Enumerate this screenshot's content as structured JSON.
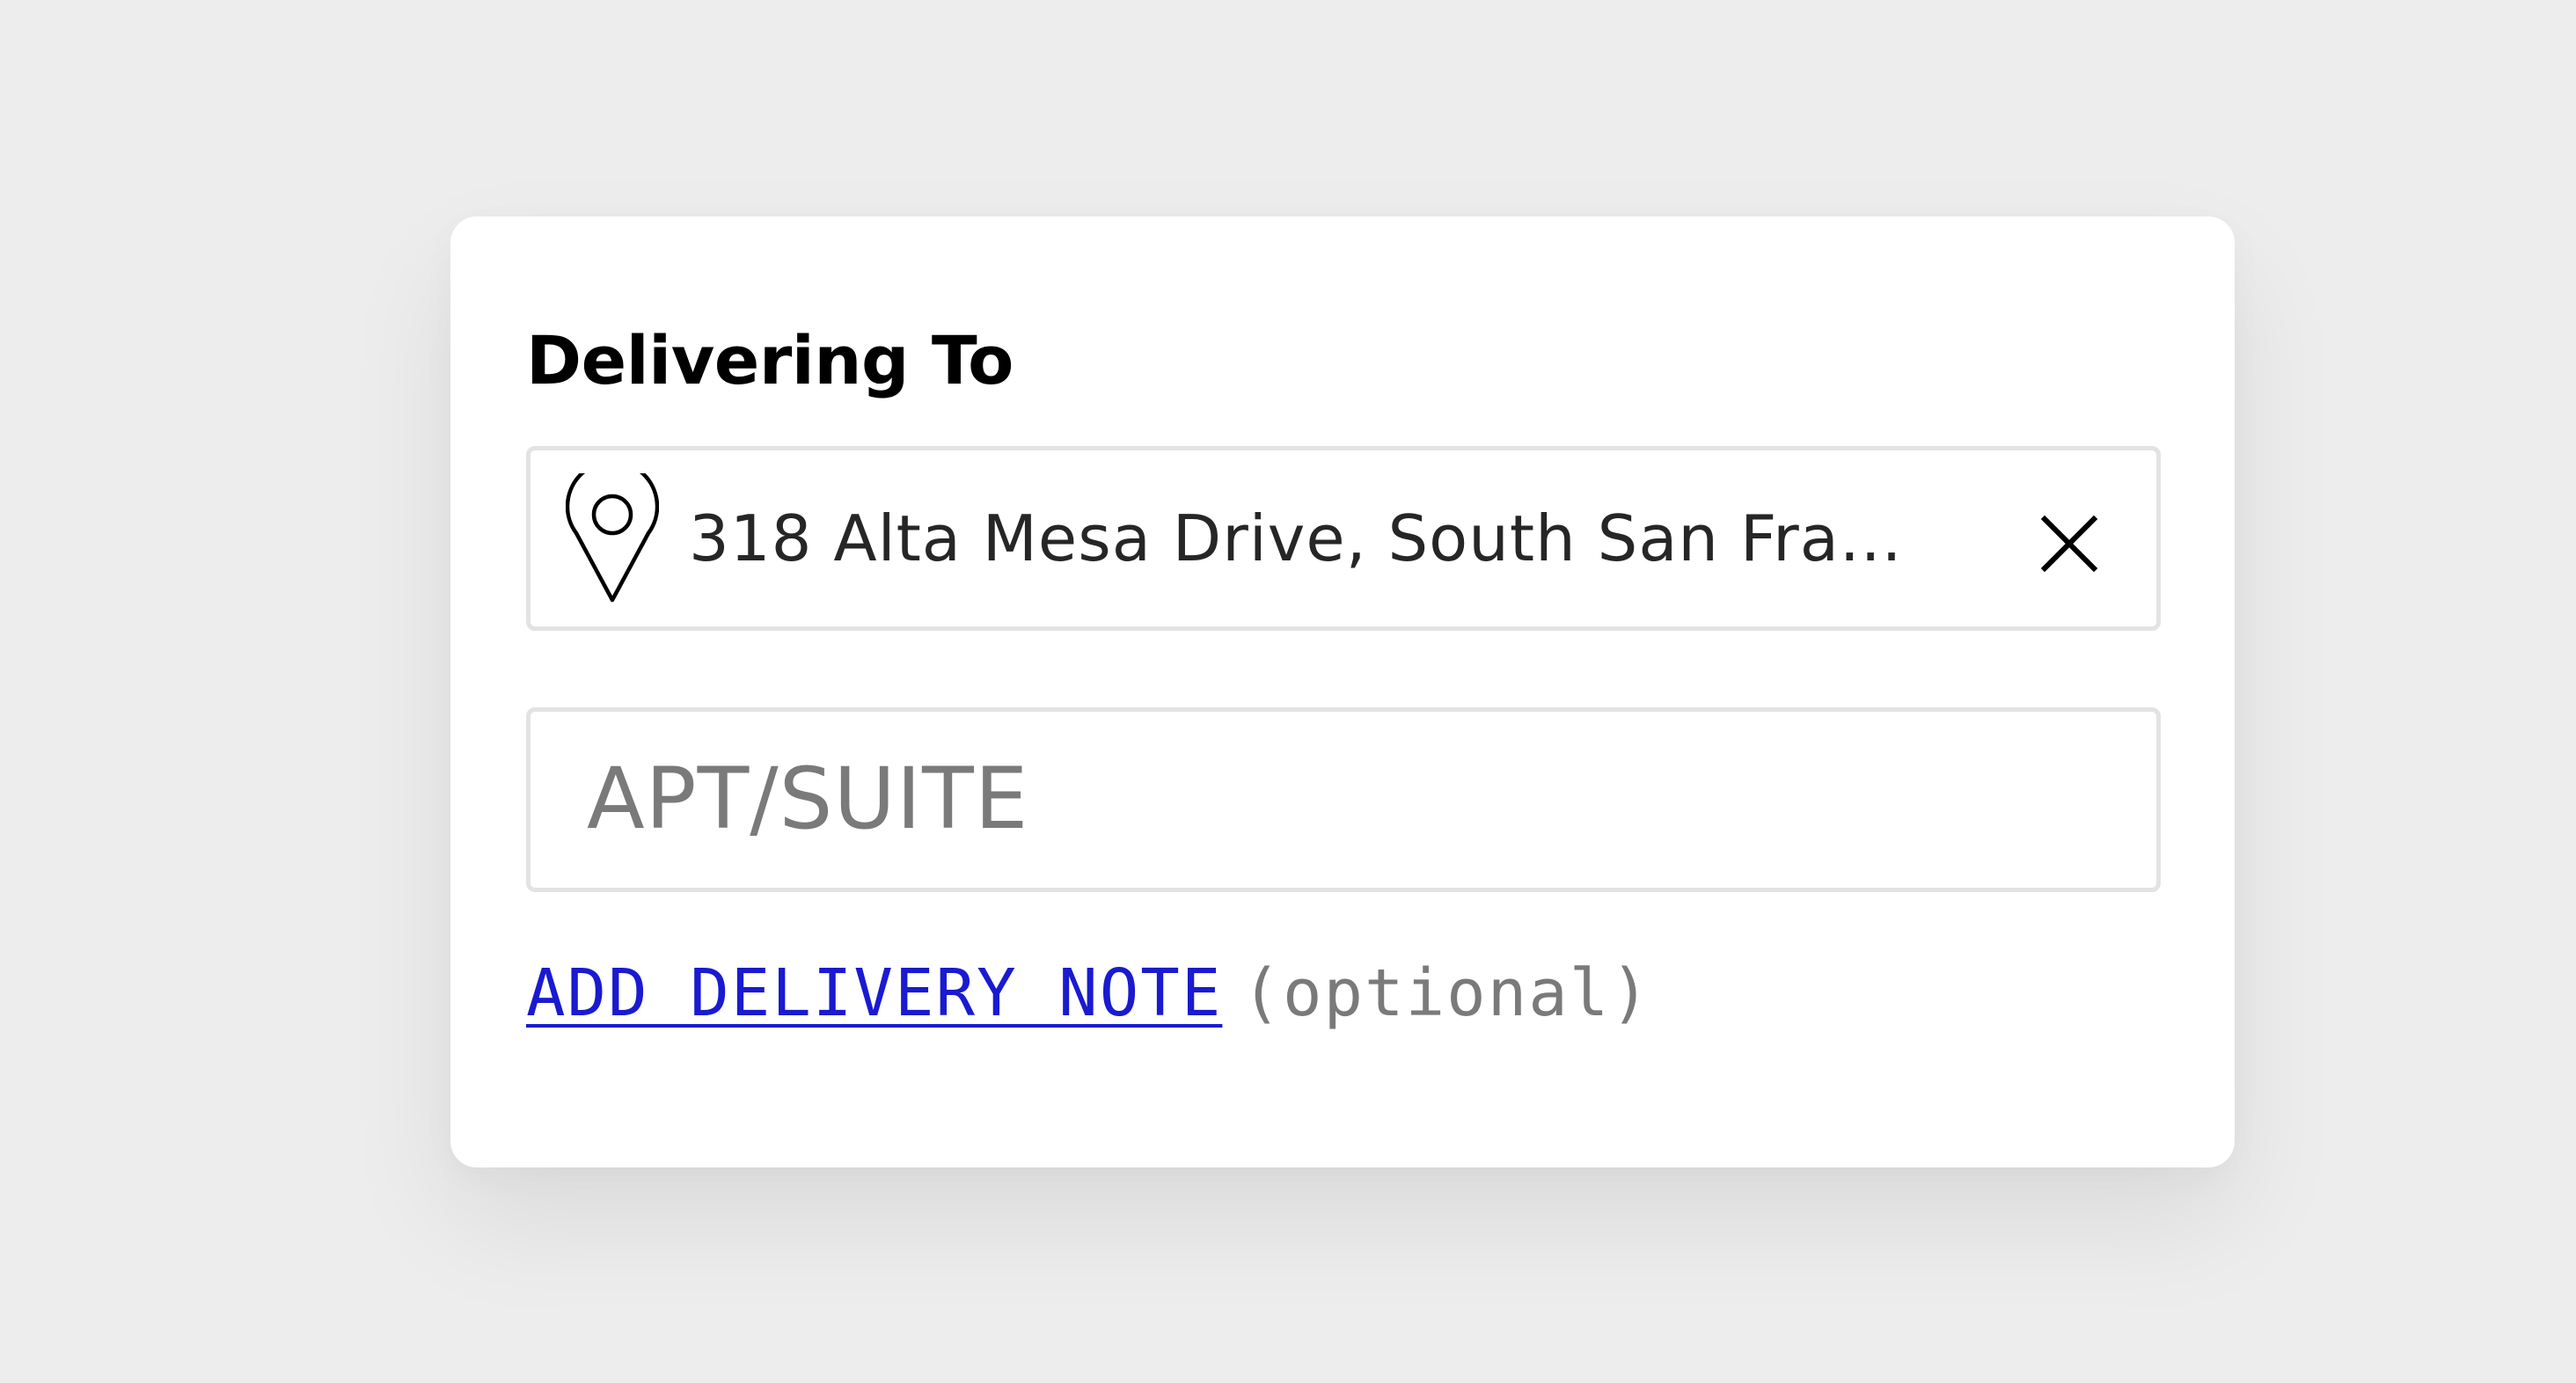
{
  "delivery": {
    "title": "Delivering To",
    "address": {
      "value": "318 Alta Mesa Drive, South San Fra...",
      "pin_icon": "map-pin-icon",
      "clear_icon": "close-icon"
    },
    "apt_suite": {
      "value": "",
      "placeholder": "APT/SUITE"
    },
    "note": {
      "link_label": "ADD DELIVERY NOTE",
      "optional_label": "(optional)",
      "link_color": "#1a1ad0"
    }
  }
}
